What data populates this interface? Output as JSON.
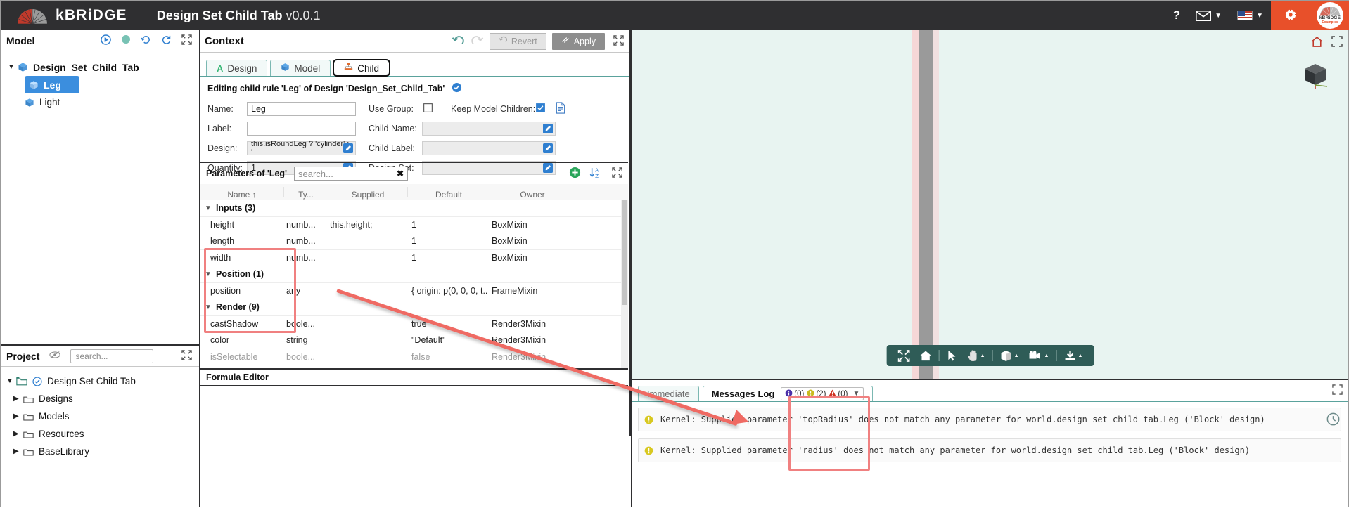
{
  "titlebar": {
    "brand": "kBRiDGE",
    "app_title": "Design Set Child Tab",
    "version": "v0.0.1",
    "help_icon": "question-mark-icon",
    "mail_icon": "envelope-icon",
    "language_icon": "us-flag-icon",
    "settings_icon": "gear-icon",
    "badge_line1": "kBRiDGE",
    "badge_line2": "Examples",
    "accent_color": "#e8502a",
    "bar_color": "#2f2f31"
  },
  "model_panel": {
    "title": "Model",
    "tree": [
      {
        "label": "Design_Set_Child_Tab",
        "level": 0,
        "expanded": true,
        "selected": false
      },
      {
        "label": "Leg",
        "level": 1,
        "expanded": false,
        "selected": true
      },
      {
        "label": "Light",
        "level": 1,
        "expanded": false,
        "selected": false
      }
    ]
  },
  "project_panel": {
    "title": "Project",
    "search_placeholder": "search...",
    "tree": [
      {
        "label": "Design Set Child Tab",
        "level": 0
      },
      {
        "label": "Designs",
        "level": 1
      },
      {
        "label": "Models",
        "level": 1
      },
      {
        "label": "Resources",
        "level": 1
      },
      {
        "label": "BaseLibrary",
        "level": 1
      }
    ]
  },
  "context_panel": {
    "title": "Context",
    "undo_label": "undo-icon",
    "redo_label": "redo-icon",
    "revert_label": "Revert",
    "apply_label": "Apply",
    "tabs": [
      {
        "label": "Design",
        "active": false,
        "icon": "letter-a-icon"
      },
      {
        "label": "Model",
        "active": false,
        "icon": "cube-icon"
      },
      {
        "label": "Child",
        "active": true,
        "icon": "hierarchy-icon"
      }
    ],
    "editing_note": "Editing child rule 'Leg' of Design 'Design_Set_Child_Tab'",
    "fields": {
      "name_label": "Name:",
      "name_value": "Leg",
      "label_label": "Label:",
      "label_value": "",
      "design_label": "Design:",
      "design_value": "this.isRoundLeg ? 'cylinder' : '",
      "quantity_label": "Quantity:",
      "quantity_value": "1",
      "use_group_label": "Use Group:",
      "use_group_checked": false,
      "keep_model_children_label": "Keep Model Children:",
      "keep_model_children_checked": true,
      "child_name_label": "Child Name:",
      "child_name_value": "",
      "child_label_label": "Child Label:",
      "child_label_value": "",
      "design_set_label": "Design Set:",
      "design_set_value": ""
    }
  },
  "parameters": {
    "title": "Parameters of 'Leg'",
    "search_placeholder": "search...",
    "clear_icon": "clear-x-icon",
    "add_icon": "add-circle-icon",
    "sort_icon": "sort-az-icon",
    "expand_icon": "expand-icon",
    "columns": [
      "Name",
      "Ty...",
      "Supplied",
      "Default",
      "Owner"
    ],
    "sort_column": "Name",
    "sort_direction": "asc",
    "groups": [
      {
        "label": "Inputs (3)",
        "expanded": true,
        "rows": [
          {
            "name": "height",
            "type": "numb...",
            "supplied": "this.height;",
            "default": "1",
            "owner": "BoxMixin"
          },
          {
            "name": "length",
            "type": "numb...",
            "supplied": "",
            "default": "1",
            "owner": "BoxMixin"
          },
          {
            "name": "width",
            "type": "numb...",
            "supplied": "",
            "default": "1",
            "owner": "BoxMixin"
          }
        ]
      },
      {
        "label": "Position (1)",
        "expanded": true,
        "rows": [
          {
            "name": "position",
            "type": "any",
            "supplied": "",
            "default": "{ origin: p(0, 0, 0, t...",
            "owner": "FrameMixin"
          }
        ]
      },
      {
        "label": "Render (9)",
        "expanded": true,
        "rows": [
          {
            "name": "castShadow",
            "type": "boole...",
            "supplied": "",
            "default": "true",
            "owner": "Render3Mixin"
          },
          {
            "name": "color",
            "type": "string",
            "supplied": "",
            "default": "\"Default\"",
            "owner": "Render3Mixin"
          },
          {
            "name": "isSelectable",
            "type": "boole...",
            "supplied": "",
            "default": "false",
            "owner": "Render3Mixin"
          }
        ]
      }
    ]
  },
  "formula_editor": {
    "title": "Formula Editor"
  },
  "viewport": {
    "home_icon": "home-icon",
    "expand_icon": "expand-icon",
    "view_cube_icon": "view-cube-icon",
    "background_color": "#e8f4f1",
    "toolbar": [
      {
        "icon": "fit-to-screen-icon",
        "label": ""
      },
      {
        "icon": "home-icon",
        "label": ""
      },
      {
        "icon": "select-arrow-icon",
        "label": ""
      },
      {
        "icon": "pan-hand-icon",
        "label": "",
        "has_dropdown": true
      },
      {
        "icon": "box-render-icon",
        "label": "",
        "has_dropdown": true
      },
      {
        "icon": "camera-icon",
        "label": "",
        "has_dropdown": true
      },
      {
        "icon": "download-icon",
        "label": "",
        "has_dropdown": true
      }
    ]
  },
  "messages": {
    "tabs": [
      {
        "label": "Immediate",
        "active": false
      },
      {
        "label": "Messages Log",
        "active": true
      }
    ],
    "counts": {
      "info_label": "(0)",
      "warning_label": "(2)",
      "error_label": "(0)"
    },
    "dropdown_icon": "chevron-down-icon",
    "expand_icon": "expand-icon",
    "filter_icon": "filter-clock-icon",
    "rows": [
      {
        "severity": "warning",
        "text": "Kernel: Supplied parameter 'topRadius' does not match any parameter for world.design_set_child_tab.Leg ('Block' design)"
      },
      {
        "severity": "warning",
        "text": "Kernel: Supplied parameter 'radius' does not match any parameter for world.design_set_child_tab.Leg ('Block' design)"
      }
    ]
  },
  "annotations": {
    "highlight_color": "#f08080",
    "arrow_color": "#ef6a63",
    "boxes": [
      {
        "name": "parameters-names-highlight"
      },
      {
        "name": "messages-topradius-highlight"
      }
    ],
    "arrow": {
      "name": "annotation-arrow"
    }
  }
}
